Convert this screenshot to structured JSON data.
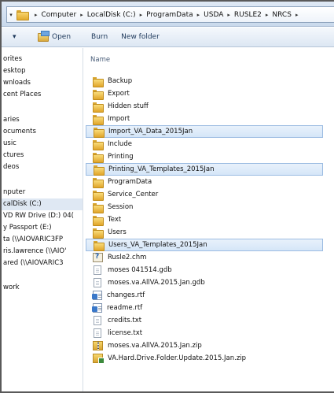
{
  "address": {
    "crumbs": [
      "Computer",
      "LocalDisk (C:)",
      "ProgramData",
      "USDA",
      "RUSLE2",
      "NRCS"
    ]
  },
  "toolbar": {
    "organize_arrow": "▾",
    "open_label": "Open",
    "burn_label": "Burn",
    "new_folder_label": "New folder"
  },
  "nav": {
    "items": [
      "orites",
      "esktop",
      "wnloads",
      "cent Places",
      "aries",
      "ocuments",
      "usic",
      "ctures",
      "deos",
      "nputer",
      "calDisk (C:)",
      "VD RW Drive (D:) 04(",
      "y Passport (E:)",
      "ta (\\\\AIOVARIC3FP",
      "ris.lawrence (\\\\AIO'",
      "ared (\\\\AIOVARIC3",
      "work"
    ]
  },
  "content": {
    "column_name": "Name",
    "files": [
      {
        "name": "Backup",
        "icon": "folder-icon"
      },
      {
        "name": "Export",
        "icon": "folder-icon"
      },
      {
        "name": "Hidden stuff",
        "icon": "folder-icon"
      },
      {
        "name": "Import",
        "icon": "folder-icon"
      },
      {
        "name": "Import_VA_Data_2015Jan",
        "icon": "folder-icon"
      },
      {
        "name": "Include",
        "icon": "folder-icon"
      },
      {
        "name": "Printing",
        "icon": "folder-icon"
      },
      {
        "name": "Printing_VA_Templates_2015Jan",
        "icon": "folder-icon"
      },
      {
        "name": "ProgramData",
        "icon": "folder-icon"
      },
      {
        "name": "Service_Center",
        "icon": "folder-icon"
      },
      {
        "name": "Session",
        "icon": "folder-icon"
      },
      {
        "name": "Text",
        "icon": "folder-icon"
      },
      {
        "name": "Users",
        "icon": "folder-icon"
      },
      {
        "name": "Users_VA_Templates_2015Jan",
        "icon": "folder-icon"
      },
      {
        "name": "Rusle2.chm",
        "icon": "help-file-icon"
      },
      {
        "name": "moses 041514.gdb",
        "icon": "document-icon"
      },
      {
        "name": "moses.va.AllVA.2015.Jan.gdb",
        "icon": "document-icon"
      },
      {
        "name": "changes.rtf",
        "icon": "rtf-document-icon"
      },
      {
        "name": "readme.rtf",
        "icon": "rtf-document-icon"
      },
      {
        "name": "credits.txt",
        "icon": "text-file-icon"
      },
      {
        "name": "license.txt",
        "icon": "text-file-icon"
      },
      {
        "name": "moses.va.AllVA.2015.Jan.zip",
        "icon": "zip-archive-icon"
      },
      {
        "name": "VA.Hard.Drive.Folder.Update.2015.Jan.zip",
        "icon": "zip-archive-icon"
      }
    ]
  }
}
